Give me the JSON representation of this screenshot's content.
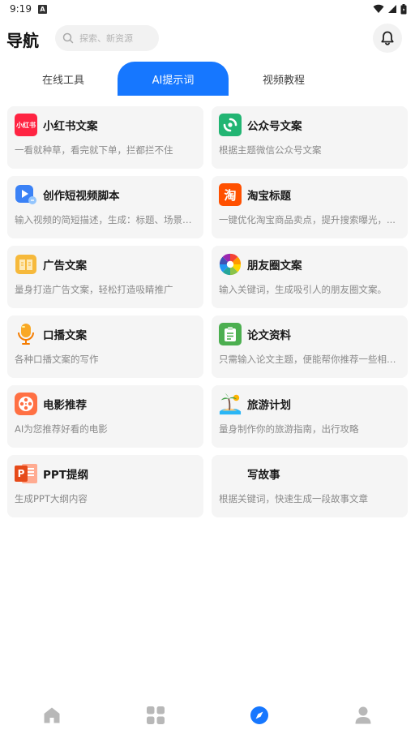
{
  "status_bar": {
    "time": "9:19",
    "notification_badge": "A"
  },
  "header": {
    "title": "导航",
    "search_placeholder": "探索、新资源"
  },
  "tabs": [
    {
      "label": "在线工具",
      "active": false
    },
    {
      "label": "AI提示词",
      "active": true
    },
    {
      "label": "视频教程",
      "active": false
    }
  ],
  "colors": {
    "accent": "#1677ff",
    "card_bg": "#f5f5f5",
    "desc": "#8a8a8a"
  },
  "cards": [
    {
      "title": "小红书文案",
      "desc": "一看就种草，看完就下单，拦都拦不住",
      "icon": "xiaohongshu-icon",
      "icon_text": "小红书"
    },
    {
      "title": "公众号文案",
      "desc": "根据主题微信公众号文案",
      "icon": "wechat-official-icon"
    },
    {
      "title": "创作短视频脚本",
      "desc": "输入视频的简短描述，生成：标题、场景、角色、台词、...",
      "icon": "video-play-icon"
    },
    {
      "title": "淘宝标题",
      "desc": "一键优化淘宝商品卖点，提升搜索曝光，...",
      "icon": "taobao-icon",
      "icon_text": "淘"
    },
    {
      "title": "广告文案",
      "desc": "量身打造广告文案，轻松打造吸睛推广",
      "icon": "book-icon"
    },
    {
      "title": "朋友圈文案",
      "desc": "输入关键词，生成吸引人的朋友圈文案。",
      "icon": "moments-aperture-icon"
    },
    {
      "title": "口播文案",
      "desc": "各种口播文案的写作",
      "icon": "microphone-icon"
    },
    {
      "title": "论文资料",
      "desc": "只需输入论文主题，便能帮你推荐一些相关论文...",
      "icon": "clipboard-icon"
    },
    {
      "title": "电影推荐",
      "desc": "AI为您推荐好看的电影",
      "icon": "film-reel-icon"
    },
    {
      "title": "旅游计划",
      "desc": "量身制作你的旅游指南，出行攻略",
      "icon": "island-icon"
    },
    {
      "title": "PPT提纲",
      "desc": "生成PPT大纲内容",
      "icon": "powerpoint-icon",
      "icon_text": "P"
    },
    {
      "title": "写故事",
      "desc": "根据关键词，快速生成一段故事文章",
      "icon": ""
    }
  ],
  "bottom_nav": [
    {
      "name": "home",
      "icon": "home-icon",
      "active": false
    },
    {
      "name": "apps",
      "icon": "grid-icon",
      "active": false
    },
    {
      "name": "discover",
      "icon": "compass-icon",
      "active": true
    },
    {
      "name": "profile",
      "icon": "user-icon",
      "active": false
    }
  ]
}
